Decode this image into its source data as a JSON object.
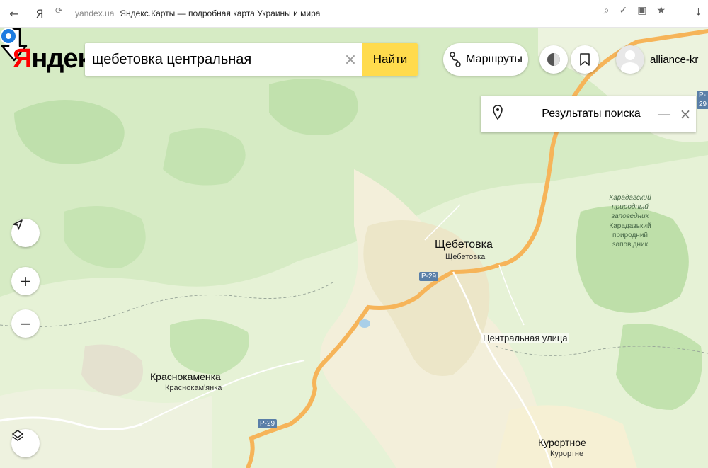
{
  "browser": {
    "back_icon": "←",
    "ya_icon": "Я",
    "domain": "yandex.ua",
    "tab_title": "Яндекс.Карты — подробная карта Украины и мира",
    "reload_icon": "⟳"
  },
  "header": {
    "logo_red": "Я",
    "logo_rest": "ндекс",
    "search_query": "щебетовка центральная",
    "clear_icon": "×",
    "find_label": "Найти",
    "routes_label": "Маршруты",
    "username": "alliance-kr"
  },
  "results_panel": {
    "title": "Результаты поиска",
    "minimize_icon": "—",
    "close_icon": "×"
  },
  "map": {
    "places": [
      {
        "id": "shchebetovka",
        "name": "Щебетовка",
        "subname": "Щебетовка"
      },
      {
        "id": "krasnokamenka",
        "name": "Краснокаменка",
        "subname": "Краснокам'янка"
      },
      {
        "id": "kurortnoe",
        "name": "Курортное",
        "subname": "Курортне"
      }
    ],
    "reserve_ru": "Карадагский природный заповедник",
    "reserve_ua": "Карадазький природний заповідник",
    "roads": [
      "P-29",
      "P-29",
      "P-29"
    ],
    "marker_label": "Центральная улица"
  },
  "colors": {
    "map_green": "#d9ecc8",
    "map_forest": "#b7dda3",
    "map_light": "#f3f0dc",
    "road_orange": "#f6b459",
    "marker_blue": "#1d7be0",
    "find_yellow": "#ffdb4d"
  }
}
